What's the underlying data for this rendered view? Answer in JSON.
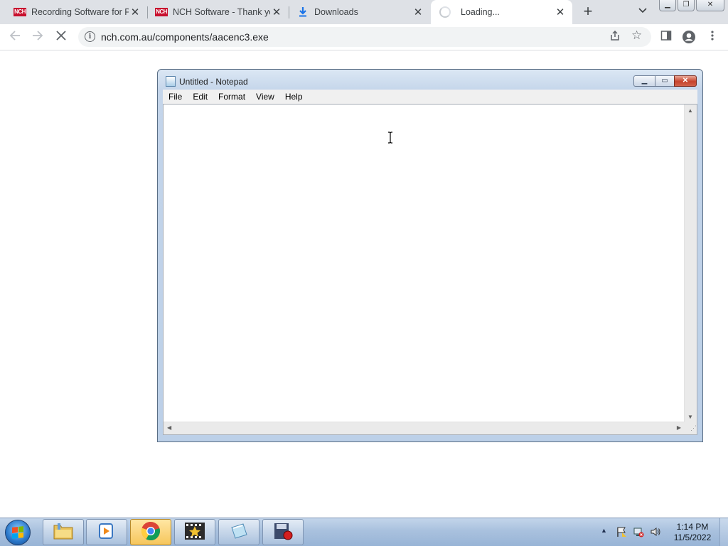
{
  "browser": {
    "tabs": [
      {
        "title": "Recording Software for Pl",
        "favicon": "nch-logo",
        "active": false
      },
      {
        "title": "NCH Software - Thank yo",
        "favicon": "nch-logo",
        "active": false
      },
      {
        "title": "Downloads",
        "favicon": "download-icon",
        "active": false
      },
      {
        "title": "Loading...",
        "favicon": "loading-spinner",
        "active": true
      }
    ],
    "nch_logo_text": "NCH",
    "new_tab_symbol": "+",
    "address": {
      "url": "nch.com.au/components/aacenc3.exe"
    }
  },
  "notepad": {
    "title": "Untitled - Notepad",
    "menu": [
      "File",
      "Edit",
      "Format",
      "View",
      "Help"
    ],
    "content": ""
  },
  "taskbar": {
    "apps": [
      "windows-explorer",
      "media-player",
      "google-chrome",
      "movie-maker",
      "notepad",
      "screen-recorder"
    ],
    "active_app": "google-chrome",
    "clock": {
      "time": "1:14 PM",
      "date": "11/5/2022"
    }
  },
  "colors": {
    "tabstrip": "#dee1e6",
    "nch_red": "#c8102e",
    "notepad_frame": "#bcd0e8",
    "close_red": "#c7442d",
    "taskbar": "#a9c1de"
  }
}
